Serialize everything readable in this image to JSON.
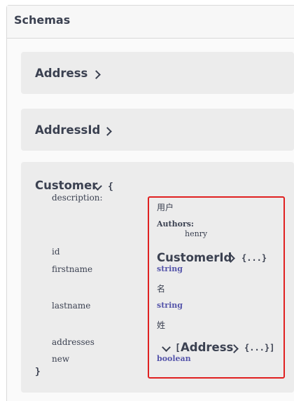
{
  "panel": {
    "title": "Schemas"
  },
  "models": {
    "address": {
      "name": "Address"
    },
    "address_id": {
      "name": "AddressId"
    },
    "customer": {
      "name": "Customer",
      "open_brace": "{",
      "close_brace": "}",
      "props": {
        "description": "description:",
        "id": "id",
        "firstname": "firstname",
        "lastname": "lastname",
        "addresses": "addresses",
        "new": "new"
      },
      "description_text": "用户",
      "authors_label": "Authors:",
      "authors_value": "henry",
      "id_ref": {
        "name": "CustomerId",
        "collapsed": "{...}"
      },
      "firstname_type": "string",
      "firstname_desc": "名",
      "lastname_type": "string",
      "lastname_desc": "姓",
      "addresses_ref": {
        "open_bracket": "[",
        "name": "Address",
        "collapsed": "{...}]"
      },
      "new_type": "boolean"
    }
  },
  "colors": {
    "highlight_border": "#e02020",
    "type_color": "#55a",
    "text": "#3b4151"
  }
}
